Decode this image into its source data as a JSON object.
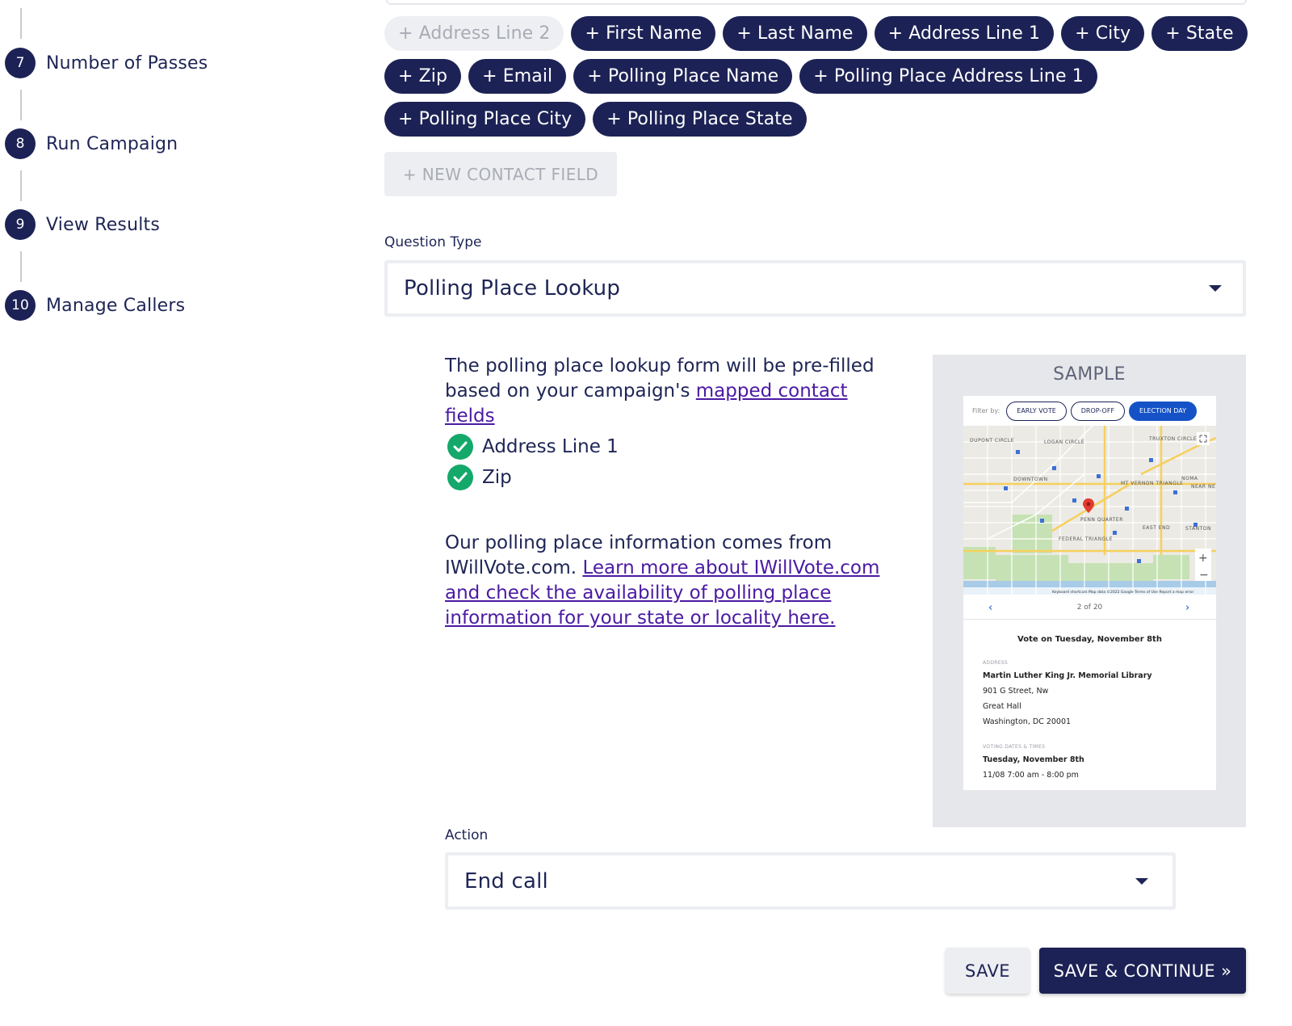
{
  "sidebar": {
    "steps": [
      {
        "number": "7",
        "label": "Number of Passes"
      },
      {
        "number": "8",
        "label": "Run Campaign"
      },
      {
        "number": "9",
        "label": "View Results"
      },
      {
        "number": "10",
        "label": "Manage Callers"
      }
    ]
  },
  "contact_fields": {
    "chips": [
      {
        "label": "+ Address Line 2",
        "disabled": true
      },
      {
        "label": "+ First Name"
      },
      {
        "label": "+ Last Name"
      },
      {
        "label": "+ Address Line 1"
      },
      {
        "label": "+ City"
      },
      {
        "label": "+ State"
      },
      {
        "label": "+ Zip"
      },
      {
        "label": "+ Email"
      },
      {
        "label": "+ Polling Place Name"
      },
      {
        "label": "+ Polling Place Address Line 1"
      },
      {
        "label": "+ Polling Place City"
      },
      {
        "label": "+ Polling Place State"
      }
    ],
    "new_field_label": "+ NEW CONTACT FIELD"
  },
  "question_type": {
    "label": "Question Type",
    "value": "Polling Place Lookup"
  },
  "info": {
    "text_before_link": "The polling place lookup form will be pre-filled based on your campaign's ",
    "mapped_link": "mapped contact fields",
    "checked_fields": [
      "Address Line 1",
      "Zip"
    ],
    "source_text": "Our polling place information comes from IWillVote.com. ",
    "learn_more_link": "Learn more about IWillVote.com and check the availability of polling place information for your state or locality here."
  },
  "sample": {
    "title": "SAMPLE",
    "filter_by": "Filter by:",
    "filters": [
      {
        "label": "EARLY VOTE",
        "active": false
      },
      {
        "label": "DROP-OFF",
        "active": false
      },
      {
        "label": "ELECTION DAY",
        "active": true
      }
    ],
    "map_labels": {
      "dupont": "DUPONT CIRCLE",
      "logan": "LOGAN CIRCLE",
      "truxton": "TRUXTON CIRCLE",
      "downtown": "DOWNTOWN",
      "mtvernon": "MT VERNON TRIANGLE",
      "noma": "NOMA",
      "penn": "PENN QUARTER",
      "eastend": "EAST END",
      "federal": "FEDERAL TRIANGLE",
      "stanton": "STANTON",
      "nearne": "NEAR NE",
      "footer": "Keyboard shortcuts   Map data ©2022 Google   Terms of Use   Report a map error"
    },
    "pager_text": "2 of 20",
    "vote_on": "Vote on Tuesday, November 8th",
    "address_heading": "ADDRESS",
    "address_lines": [
      "Martin Luther King Jr. Memorial Library",
      "901 G Street, Nw",
      "Great Hall",
      "Washington, DC 20001"
    ],
    "dates_heading": "VOTING DATES & TIMES",
    "date_line": "Tuesday, November 8th",
    "time_line": "11/08 7:00 am - 8:00 pm"
  },
  "action": {
    "label": "Action",
    "value": "End call"
  },
  "buttons": {
    "save": "SAVE",
    "save_continue": "SAVE & CONTINUE »"
  },
  "colors": {
    "navy": "#1c2255",
    "link": "#4b1aa3",
    "check_green": "#15a86b",
    "filter_active": "#1552c7"
  }
}
